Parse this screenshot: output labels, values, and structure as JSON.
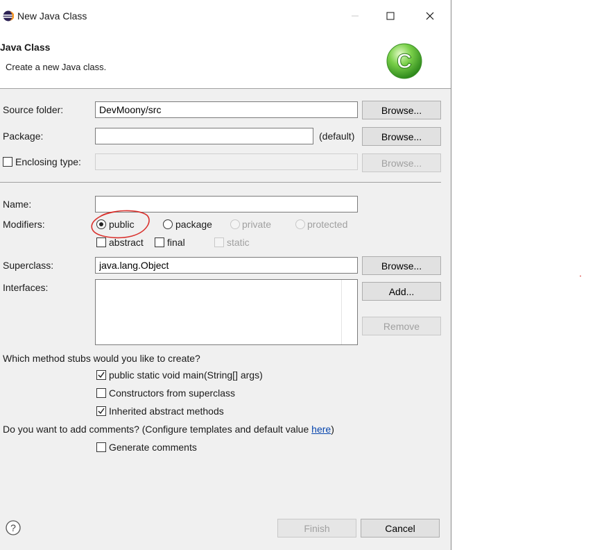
{
  "window": {
    "title": "New Java Class",
    "controls": [
      "minimize",
      "maximize",
      "close"
    ]
  },
  "header": {
    "title": "Java Class",
    "description": "Create a new Java class.",
    "badge_icon": "java-class-c-badge",
    "badge_letter": "C"
  },
  "form": {
    "source_folder": {
      "label": "Source folder:",
      "value": "DevMoony/src",
      "button": "Browse..."
    },
    "package": {
      "label": "Package:",
      "value": "",
      "hint": "(default)",
      "button": "Browse..."
    },
    "enclosing_type": {
      "label": "Enclosing type:",
      "checked": false,
      "value": "",
      "button": "Browse...",
      "enabled": false
    },
    "name": {
      "label": "Name:",
      "value": ""
    },
    "modifiers": {
      "label": "Modifiers:",
      "access": [
        {
          "label": "public",
          "selected": true,
          "enabled": true
        },
        {
          "label": "package",
          "selected": false,
          "enabled": true
        },
        {
          "label": "private",
          "selected": false,
          "enabled": false
        },
        {
          "label": "protected",
          "selected": false,
          "enabled": false
        }
      ],
      "flags": [
        {
          "label": "abstract",
          "checked": false,
          "enabled": true
        },
        {
          "label": "final",
          "checked": false,
          "enabled": true
        },
        {
          "label": "static",
          "checked": false,
          "enabled": false
        }
      ]
    },
    "superclass": {
      "label": "Superclass:",
      "value": "java.lang.Object",
      "button": "Browse..."
    },
    "interfaces": {
      "label": "Interfaces:",
      "items": [],
      "add_button": "Add...",
      "remove_button": "Remove"
    }
  },
  "stubs": {
    "question": "Which method stubs would you like to create?",
    "options": [
      {
        "label": "public static void main(String[] args)",
        "checked": true
      },
      {
        "label": "Constructors from superclass",
        "checked": false
      },
      {
        "label": "Inherited abstract methods",
        "checked": true
      }
    ]
  },
  "comments": {
    "question_prefix": "Do you want to add comments? (Configure templates and default value ",
    "link_text": "here",
    "question_suffix": ")",
    "option": {
      "label": "Generate comments",
      "checked": false
    }
  },
  "footer": {
    "help_icon": "question-mark",
    "finish": "Finish",
    "cancel": "Cancel"
  },
  "colors": {
    "dialog_bg": "#f0f0f0",
    "header_bg": "#ffffff",
    "link": "#0645ad",
    "annotation_red": "#d9302c",
    "badge_green": "#4caf32"
  }
}
